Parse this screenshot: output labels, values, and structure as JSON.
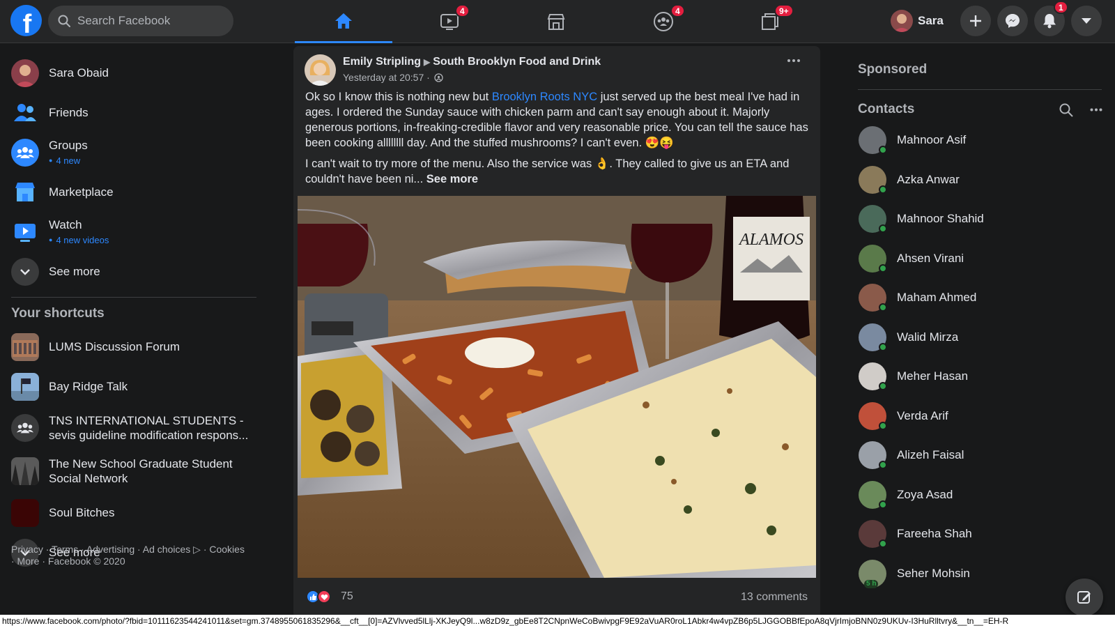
{
  "topbar": {
    "search_placeholder": "Search Facebook",
    "tabs": [
      {
        "name": "home",
        "badge": ""
      },
      {
        "name": "watch",
        "badge": "4"
      },
      {
        "name": "marketplace",
        "badge": ""
      },
      {
        "name": "groups",
        "badge": "4"
      },
      {
        "name": "gaming",
        "badge": "9+"
      }
    ],
    "profile_name": "Sara",
    "notifications_badge": "1"
  },
  "sidebar": {
    "items": [
      {
        "label": "Sara Obaid",
        "sub": ""
      },
      {
        "label": "Friends",
        "sub": ""
      },
      {
        "label": "Groups",
        "sub": "4 new"
      },
      {
        "label": "Marketplace",
        "sub": ""
      },
      {
        "label": "Watch",
        "sub": "4 new videos"
      },
      {
        "label": "See more",
        "sub": ""
      }
    ],
    "shortcuts_title": "Your shortcuts",
    "shortcuts": [
      {
        "label": "LUMS Discussion Forum"
      },
      {
        "label": "Bay Ridge Talk"
      },
      {
        "label": "TNS INTERNATIONAL STUDENTS - sevis guideline modification respons..."
      },
      {
        "label": "The New School Graduate Student Social Network"
      },
      {
        "label": "Soul Bitches"
      },
      {
        "label": "See more"
      }
    ],
    "footer": "Privacy · Terms · Advertising · Ad choices ▷ · Cookies · More · Facebook © 2020"
  },
  "post": {
    "author": "Emily Stripling",
    "group": "South Brooklyn Food and Drink",
    "time": "Yesterday at 20:57 ·",
    "text1_before": "Ok so I know this is nothing new but ",
    "text1_link": "Brooklyn Roots NYC",
    "text1_after": " just served up the best meal I've had in ages. I ordered the Sunday sauce with chicken parm and can't say enough about it. Majorly generous portions, in-freaking-credible flavor and very reasonable price. You can tell the sauce has been cooking allllllll day. And the stuffed mushrooms? I can't even. 😍😝",
    "text2": "I can't wait to try more of the menu. Also the service was 👌. They called to give us an ETA and couldn't have been ni... ",
    "see_more": "See more",
    "reaction_count": "75",
    "comments": "13 comments",
    "image_label": "ALAMOS"
  },
  "right": {
    "sponsored": "Sponsored",
    "contacts_title": "Contacts",
    "contacts": [
      {
        "name": "Mahnoor Asif",
        "color": "#6b6f74"
      },
      {
        "name": "Azka Anwar",
        "color": "#8a7a5a"
      },
      {
        "name": "Mahnoor Shahid",
        "color": "#4a6a5a"
      },
      {
        "name": "Ahsen Virani",
        "color": "#5a7a4a"
      },
      {
        "name": "Maham Ahmed",
        "color": "#8a5a4a"
      },
      {
        "name": "Walid Mirza",
        "color": "#7a8aa0"
      },
      {
        "name": "Meher Hasan",
        "color": "#d0ccc8"
      },
      {
        "name": "Verda Arif",
        "color": "#c0503a"
      },
      {
        "name": "Alizeh Faisal",
        "color": "#9aa0a8"
      },
      {
        "name": "Zoya Asad",
        "color": "#6a8a5a"
      },
      {
        "name": "Fareeha Shah",
        "color": "#5a3a3a"
      },
      {
        "name": "Seher Mohsin",
        "color": "#7a8a6a",
        "status": "5 h"
      }
    ]
  },
  "statusbar": "https://www.facebook.com/photo/?fbid=10111623544241011&set=gm.3748955061835296&__cft__[0]=AZVlvved5lLlj-XKJeyQ9l...w8zD9z_gbEe8T2CNpnWeCoBwivpgF9E92aVuAR0roL1Abkr4w4vpZB6p5LJGGOBBfEpoA8qVjrImjoBNN0z9UKUv-I3HuRlltvry&__tn__=EH-R",
  "colors": {
    "accent": "#2d88ff",
    "badge": "#e41e3f",
    "online": "#31a24c"
  }
}
